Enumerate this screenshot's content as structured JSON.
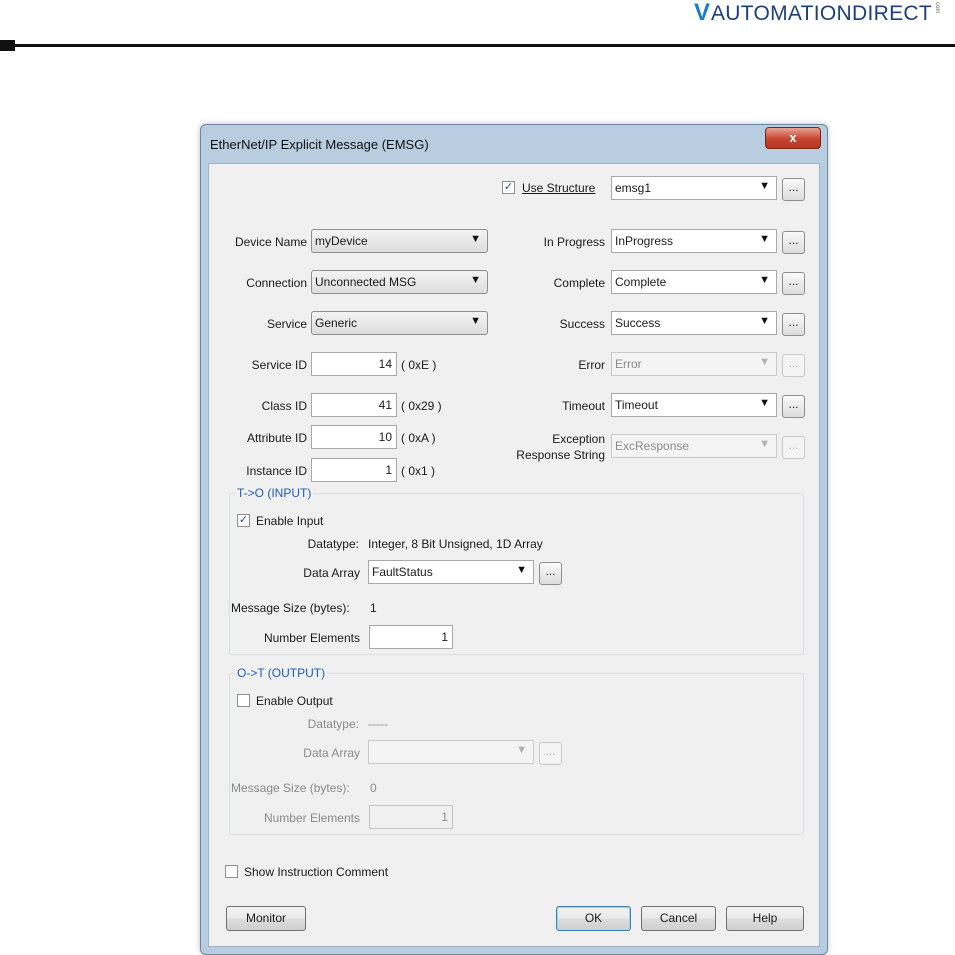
{
  "page": {
    "brand": "AUTOMATIONDIRECT",
    "brand_mark": "V",
    "brand_tm": "com"
  },
  "dialog": {
    "title": "EtherNet/IP Explicit Message (EMSG)",
    "close_glyph": "x",
    "use_structure": {
      "label": "Use Structure",
      "checked": true,
      "value": "emsg1"
    },
    "left_fields": {
      "device_name": {
        "label": "Device Name",
        "value": "myDevice"
      },
      "connection": {
        "label": "Connection",
        "value": "Unconnected MSG"
      },
      "service": {
        "label": "Service",
        "value": "Generic"
      },
      "service_id": {
        "label": "Service ID",
        "value": "14",
        "hex": "( 0xE )"
      },
      "class_id": {
        "label": "Class ID",
        "value": "41",
        "hex": "( 0x29 )"
      },
      "attribute_id": {
        "label": "Attribute ID",
        "value": "10",
        "hex": "( 0xA )"
      },
      "instance_id": {
        "label": "Instance ID",
        "value": "1",
        "hex": "( 0x1 )"
      }
    },
    "right_fields": {
      "in_progress": {
        "label": "In Progress",
        "value": "InProgress"
      },
      "complete": {
        "label": "Complete",
        "value": "Complete"
      },
      "success": {
        "label": "Success",
        "value": "Success"
      },
      "error": {
        "label": "Error",
        "value": "Error",
        "enabled": false
      },
      "timeout": {
        "label": "Timeout",
        "value": "Timeout"
      },
      "exception": {
        "label_line1": "Exception",
        "label_line2": "Response String",
        "value": "ExcResponse",
        "enabled": false
      }
    },
    "input_group": {
      "title": "T->O (INPUT)",
      "enable_label": "Enable Input",
      "enabled": true,
      "datatype_label": "Datatype:",
      "datatype_value": "Integer, 8 Bit Unsigned, 1D Array",
      "data_array_label": "Data Array",
      "data_array_value": "FaultStatus",
      "message_size_label": "Message Size (bytes):",
      "message_size_value": "1",
      "number_elements_label": "Number Elements",
      "number_elements_value": "1"
    },
    "output_group": {
      "title": "O->T (OUTPUT)",
      "enable_label": "Enable Output",
      "enabled": false,
      "datatype_label": "Datatype:",
      "datatype_value": "-----",
      "data_array_label": "Data Array",
      "data_array_value": "",
      "message_size_label": "Message Size (bytes):",
      "message_size_value": "0",
      "number_elements_label": "Number Elements",
      "number_elements_value": "1"
    },
    "show_comment": {
      "label": "Show Instruction Comment",
      "checked": false
    },
    "buttons": {
      "monitor": "Monitor",
      "ok": "OK",
      "cancel": "Cancel",
      "help": "Help"
    },
    "ellipsis": "...",
    "arrow": "▼",
    "check_glyph": "✓"
  },
  "colors": {
    "group_title": "#1f5bb5",
    "title_bar": "#b8cde0",
    "close_button": "#c64430",
    "brand": "#1d3f7c"
  }
}
